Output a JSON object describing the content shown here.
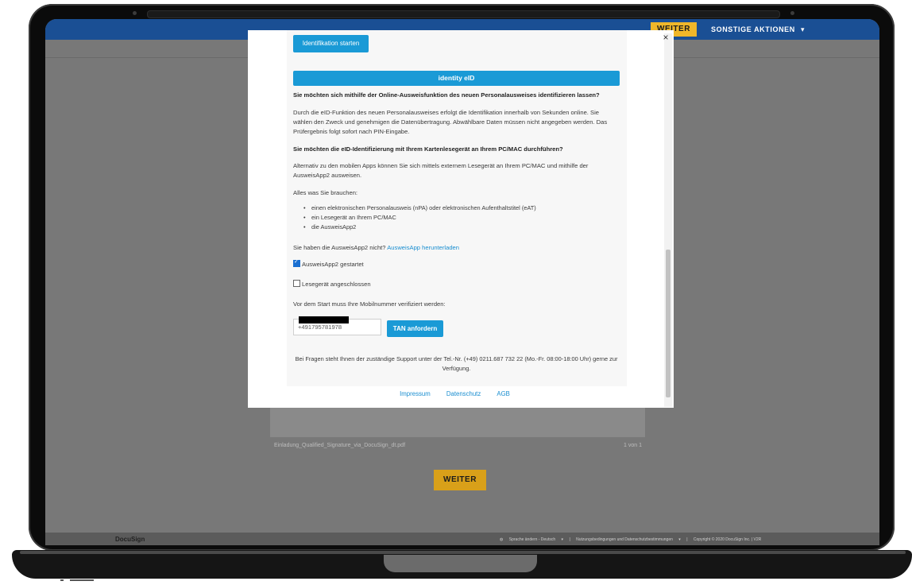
{
  "app": {
    "top_weiter": "WEITER",
    "sonstige_aktionen": "SONSTIGE AKTIONEN",
    "filename": "Einladung_Qualified_Signature_via_DocuSign_dt.pdf",
    "page_count": "1 von 1",
    "bottom_weiter": "WEITER",
    "brand": "DocuSign",
    "footer": {
      "language": "Sprache ändern - Deutsch",
      "terms": "Nutzungsbedingungen und Datenschutzbestimmungen",
      "copyright": "Copyright © 2020 DocuSign Inc. | V2R"
    }
  },
  "modal": {
    "start_button": "Identifikation starten",
    "section_title": "identity eID",
    "q1": "Sie möchten sich mithilfe der Online-Ausweisfunktion des neuen Personalausweises identifizieren lassen?",
    "p1": "Durch die eID-Funktion des neuen Personalausweises erfolgt die Identifikation innerhalb von Sekunden online. Sie wählen den Zweck und genehmigen die Datenübertragung. Abwählbare Daten müssen nicht angegeben werden. Das Prüfergebnis folgt sofort nach PIN-Eingabe.",
    "q2": "Sie möchten die eID-Identifizierung mit Ihrem Kartenlesegerät an Ihrem PC/MAC durchführen?",
    "p2": "Alternativ zu den mobilen Apps können Sie sich mittels externem Lesegerät an Ihrem PC/MAC und mithilfe der AusweisApp2 ausweisen.",
    "needs_label": "Alles was Sie brauchen:",
    "needs": [
      "einen elektronischen Personalausweis (nPA) oder elektronischen Aufenthaltstitel (eAT)",
      "ein Lesegerät an Ihrem PC/MAC",
      "die AusweisApp2"
    ],
    "download_prefix": "Sie haben die AusweisApp2 nicht?",
    "download_link": "AusweisApp herunterladen",
    "checkbox1": {
      "label": "AusweisApp2 gestartet",
      "checked": true
    },
    "checkbox2": {
      "label": "Lesegerät angeschlossen",
      "checked": false
    },
    "verify_label": "Vor dem Start muss Ihre Mobilnummer verifiziert werden:",
    "phone_value": "+491795781978",
    "tan_button": "TAN anfordern",
    "support": "Bei Fragen steht Ihnen der zuständige Support unter der Tel.-Nr. (+49) 0211.687 732 22 (Mo.-Fr. 08:00-18:00 Uhr) gerne zur Verfügung.",
    "links": [
      "Impressum",
      "Datenschutz",
      "AGB"
    ],
    "close": "×"
  }
}
